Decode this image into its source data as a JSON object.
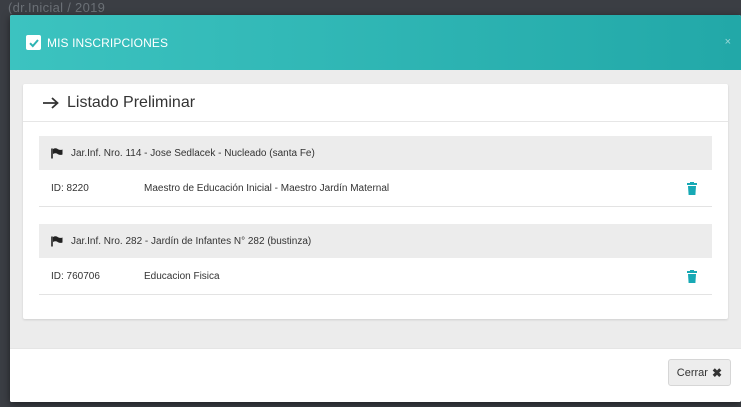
{
  "backdrop": {
    "text": "(dr.Inicial / 2019"
  },
  "modal": {
    "title": "MIS INSCRIPCIONES",
    "close_symbol": "×",
    "header_color": "#2eb4b4"
  },
  "card": {
    "title": "Listado Preliminar",
    "groups": [
      {
        "school": "Jar.Inf. Nro. 114 - Jose Sedlacek - Nucleado (santa Fe)",
        "rows": [
          {
            "id": "ID: 8220",
            "description": "Maestro de Educación Inicial - Maestro Jardín Maternal"
          }
        ]
      },
      {
        "school": "Jar.Inf. Nro. 282 - Jardín de Infantes N° 282 (bustinza)",
        "rows": [
          {
            "id": "ID: 760706",
            "description": "Educacion Fisica"
          }
        ]
      }
    ]
  },
  "footer": {
    "close_label": "Cerrar",
    "close_icon": "✖"
  },
  "icons": {
    "checkbox": "check-icon",
    "arrow": "arrow-right-icon",
    "flag": "flag-icon",
    "delete": "trash-icon",
    "accent": "#17a9b5"
  }
}
